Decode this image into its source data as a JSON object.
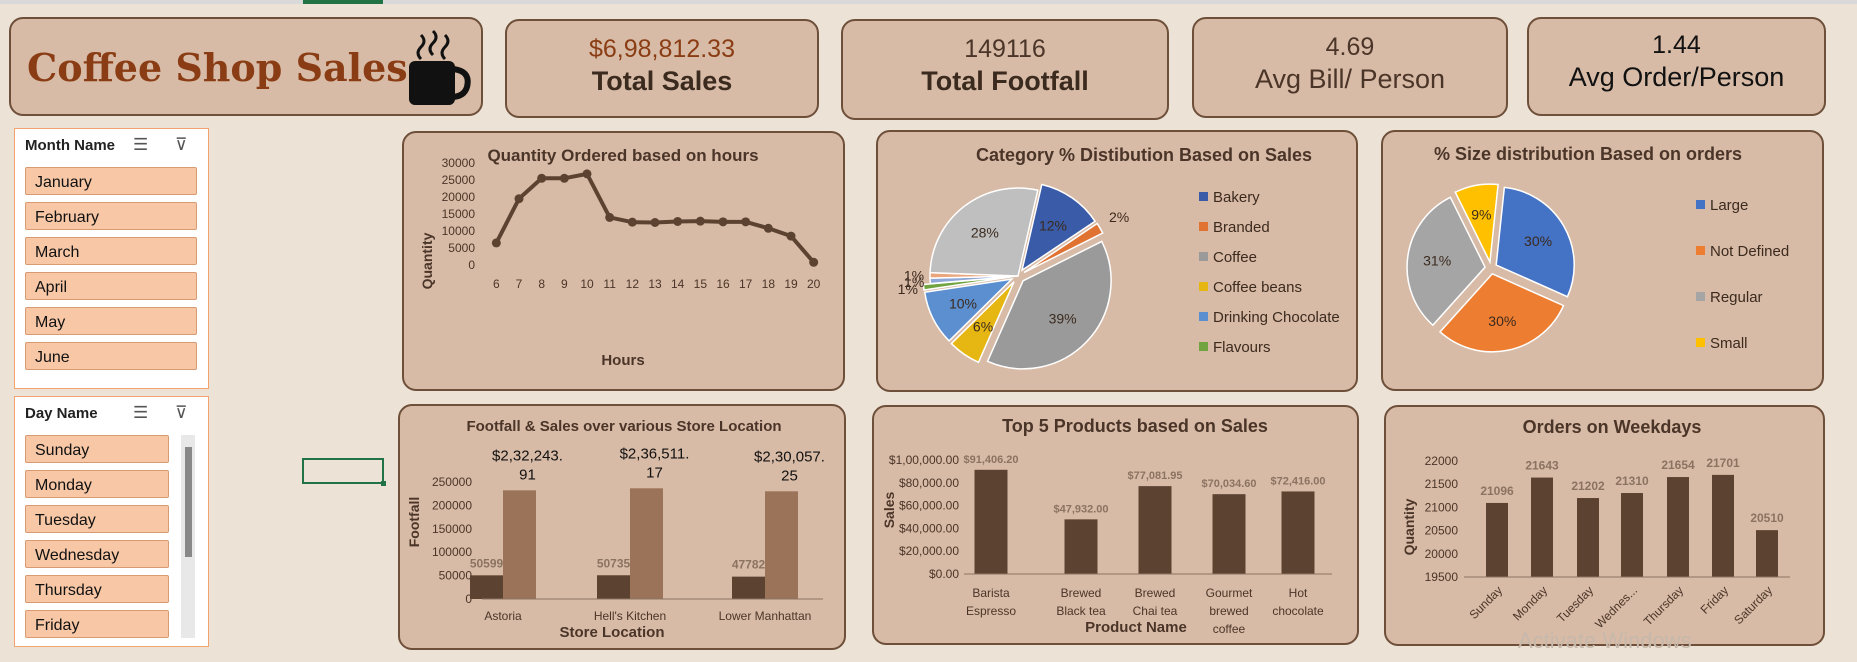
{
  "title": "Coffee Shop Sales",
  "cup_icon": "coffee-cup-icon",
  "kpis": [
    {
      "value": "$6,98,812.33",
      "label": "Total Sales",
      "color": "#8a3d14"
    },
    {
      "value": "149116",
      "label": "Total Footfall",
      "color": "#4a3528"
    },
    {
      "value": "4.69",
      "label": "Avg Bill/ Person",
      "color": "#4a3528"
    },
    {
      "value": "1.44",
      "label": "Avg Order/Person",
      "color": "#111111"
    }
  ],
  "month_slicer": {
    "header": "Month Name",
    "items": [
      "January",
      "February",
      "March",
      "April",
      "May",
      "June"
    ]
  },
  "day_slicer": {
    "header": "Day Name",
    "items": [
      "Sunday",
      "Monday",
      "Tuesday",
      "Wednesday",
      "Thursday",
      "Friday"
    ]
  },
  "watermark": "Activate Windows",
  "chart_data": [
    {
      "id": "hours",
      "type": "line",
      "title": "Quantity Ordered based on hours",
      "xlabel": "Hours",
      "ylabel": "Quantity",
      "x": [
        6,
        7,
        8,
        9,
        10,
        11,
        12,
        13,
        14,
        15,
        16,
        17,
        18,
        19,
        20
      ],
      "values": [
        6500,
        19500,
        25500,
        25500,
        26800,
        14000,
        12600,
        12500,
        12800,
        12900,
        12700,
        12700,
        10800,
        8500,
        800
      ],
      "ylim": [
        0,
        30000
      ],
      "yticks": [
        0,
        5000,
        10000,
        15000,
        20000,
        25000,
        30000
      ],
      "color": "#5c4331"
    },
    {
      "id": "category",
      "type": "pie",
      "title": "Category % Distibution Based on Sales",
      "slices": [
        {
          "name": "Bakery",
          "value": 12,
          "label": "12%",
          "color": "#3a5ba8"
        },
        {
          "name": "Branded",
          "value": 2,
          "label": "2%",
          "color": "#e07232"
        },
        {
          "name": "Coffee",
          "value": 39,
          "label": "39%",
          "color": "#9a9a9a"
        },
        {
          "name": "Coffee beans",
          "value": 6,
          "label": "6%",
          "color": "#e6b712"
        },
        {
          "name": "Drinking Chocolate",
          "value": 10,
          "label": "10%",
          "color": "#5b8fd0"
        },
        {
          "name": "Flavours",
          "value": 1,
          "label": "1%",
          "color": "#71a441"
        },
        {
          "name": "",
          "value": 1,
          "label": "1%",
          "color": "#8fa8d8"
        },
        {
          "name": "",
          "value": 1,
          "label": "1%",
          "color": "#e9a57c"
        },
        {
          "name": "",
          "value": 28,
          "label": "28%",
          "color": "#bfbfbf"
        }
      ],
      "legend": [
        "Bakery",
        "Branded",
        "Coffee",
        "Coffee beans",
        "Drinking Chocolate",
        "Flavours"
      ],
      "legend_colors": [
        "#3a5ba8",
        "#e07232",
        "#9a9a9a",
        "#e6b712",
        "#5b8fd0",
        "#71a441"
      ]
    },
    {
      "id": "size",
      "type": "pie",
      "title": "% Size distribution Based on orders",
      "slices": [
        {
          "name": "Large",
          "value": 30,
          "label": "30%",
          "color": "#4472c4"
        },
        {
          "name": "Not Defined",
          "value": 30,
          "label": "30%",
          "color": "#ed7d31"
        },
        {
          "name": "Regular",
          "value": 31,
          "label": "31%",
          "color": "#a5a5a5"
        },
        {
          "name": "Small",
          "value": 9,
          "label": "9%",
          "color": "#ffc000"
        }
      ],
      "legend": [
        "Large",
        "Not Defined",
        "Regular",
        "Small"
      ],
      "legend_colors": [
        "#4472c4",
        "#ed7d31",
        "#a5a5a5",
        "#ffc000"
      ]
    },
    {
      "id": "store",
      "type": "bar",
      "title": "Footfall & Sales over various Store Location",
      "xlabel": "Store Location",
      "ylabel": "Footfall",
      "categories": [
        "Astoria",
        "Hell's Kitchen",
        "Lower Manhattan"
      ],
      "series": [
        {
          "values": [
            50599,
            50735,
            47782
          ],
          "labels": [
            "50599",
            "50735",
            "47782"
          ],
          "color": "#5c4331"
        },
        {
          "values": [
            232243.91,
            236511.17,
            230057.25
          ],
          "labels": [
            "$2,32,243.|91",
            "$2,36,511.|17",
            "$2,30,057.|25"
          ],
          "color": "#9a7358"
        }
      ],
      "ylim": [
        0,
        250000
      ],
      "yticks": [
        0,
        50000,
        100000,
        150000,
        200000,
        250000
      ]
    },
    {
      "id": "products",
      "type": "bar",
      "title": "Top 5 Products based on Sales",
      "xlabel": "Product Name",
      "ylabel": "Sales",
      "categories": [
        "Barista|Espresso",
        "Brewed|Black tea",
        "Brewed|Chai tea",
        "Gourmet|brewed|coffee",
        "Hot|chocolate"
      ],
      "values": [
        91406.2,
        47932.0,
        77081.95,
        70034.6,
        72416.0
      ],
      "labels": [
        "$91,406.20",
        "$47,932.00",
        "$77,081.95",
        "$70,034.60",
        "$72,416.00"
      ],
      "ylim": [
        0,
        100000
      ],
      "yticks": [
        0,
        20000,
        40000,
        60000,
        80000,
        100000
      ],
      "ytick_labels": [
        "$0.00",
        "$20,000.00",
        "$40,000.00",
        "$60,000.00",
        "$80,000.00",
        "$1,00,000.00"
      ],
      "color": "#5c4331"
    },
    {
      "id": "weekdays",
      "type": "bar",
      "title": "Orders on Weekdays",
      "ylabel": "Quantity",
      "categories": [
        "Sunday",
        "Monday",
        "Tuesday",
        "Wednes...",
        "Thursday",
        "Friday",
        "Saturday"
      ],
      "values": [
        21096,
        21643,
        21202,
        21310,
        21654,
        21701,
        20510
      ],
      "ylim": [
        19500,
        22000
      ],
      "yticks": [
        19500,
        20000,
        20500,
        21000,
        21500,
        22000
      ],
      "color": "#5c4331"
    }
  ]
}
